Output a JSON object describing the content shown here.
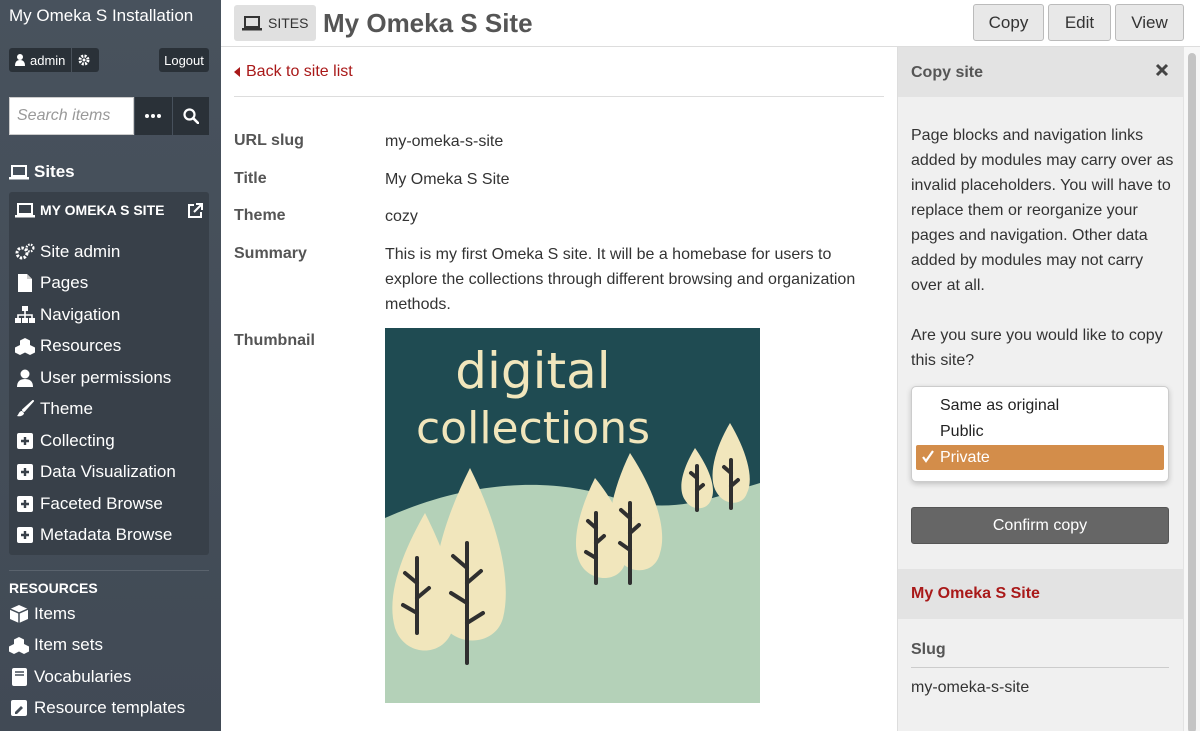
{
  "sidebar": {
    "install_title": "My Omeka S Installation",
    "user": "admin",
    "logout": "Logout",
    "search_placeholder": "Search items",
    "sites_heading": "Sites",
    "site_name": "MY OMEKA S SITE",
    "site_nav": [
      {
        "label": "Site admin",
        "icon": "gears-icon"
      },
      {
        "label": "Pages",
        "icon": "file-icon"
      },
      {
        "label": "Navigation",
        "icon": "sitemap-icon"
      },
      {
        "label": "Resources",
        "icon": "cubes-icon"
      },
      {
        "label": "User permissions",
        "icon": "user-icon"
      },
      {
        "label": "Theme",
        "icon": "paintbrush-icon"
      },
      {
        "label": "Collecting",
        "icon": "plus-square-icon"
      },
      {
        "label": "Data Visualization",
        "icon": "plus-square-icon"
      },
      {
        "label": "Faceted Browse",
        "icon": "plus-square-icon"
      },
      {
        "label": "Metadata Browse",
        "icon": "plus-square-icon"
      }
    ],
    "resources_heading": "RESOURCES",
    "resources": [
      {
        "label": "Items",
        "icon": "cube-icon"
      },
      {
        "label": "Item sets",
        "icon": "cubes-icon"
      },
      {
        "label": "Vocabularies",
        "icon": "book-icon"
      },
      {
        "label": "Resource templates",
        "icon": "template-icon"
      }
    ]
  },
  "header": {
    "section_label": "SITES",
    "page_title": "My Omeka S Site",
    "buttons": [
      "Copy",
      "Edit",
      "View"
    ]
  },
  "main": {
    "back_link": "Back to site list",
    "properties": [
      {
        "label": "URL slug",
        "value": "my-omeka-s-site"
      },
      {
        "label": "Title",
        "value": "My Omeka S Site"
      },
      {
        "label": "Theme",
        "value": "cozy"
      },
      {
        "label": "Summary",
        "value": "This is my first Omeka S site. It will be a homebase for users to explore the collections through different browsing and organization methods."
      },
      {
        "label": "Thumbnail",
        "value": ""
      }
    ],
    "thumbnail_text": [
      "digital",
      "collections"
    ]
  },
  "panel": {
    "title": "Copy site",
    "warning": "Page blocks and navigation links added by modules may carry over as invalid placeholders. You will have to replace them or reorganize your pages and navigation. Other data added by modules may not carry over at all.",
    "confirm_question": "Are you sure you would like to copy this site?",
    "visibility_options": [
      "Same as original",
      "Public",
      "Private"
    ],
    "selected_option": "Private",
    "confirm_button": "Confirm copy",
    "site_section_title": "My Omeka S Site",
    "slug_label": "Slug",
    "slug_value": "my-omeka-s-site"
  },
  "colors": {
    "sidebar_bg": "#454e58",
    "link_red": "#a91919",
    "selected_option": "#d38d4a",
    "thumbnail_dark": "#1f4b52",
    "thumbnail_hill": "#b4d1b8",
    "thumbnail_tree": "#f1e6bc"
  }
}
